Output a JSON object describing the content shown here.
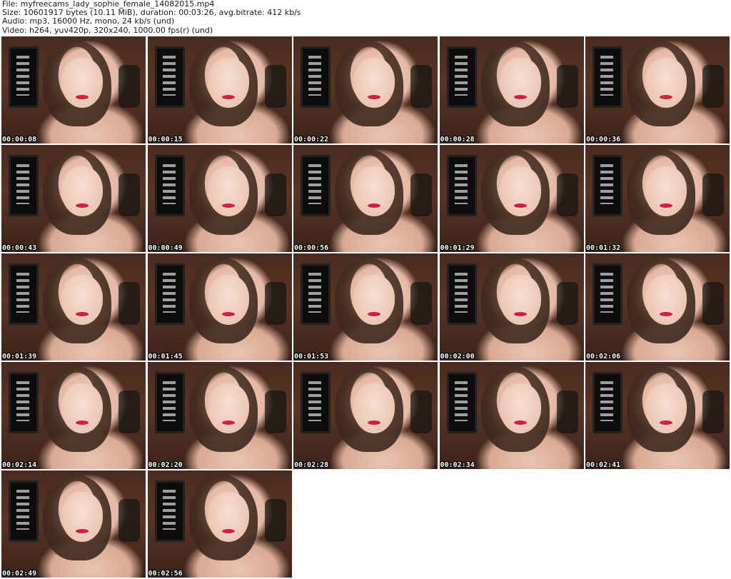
{
  "header": {
    "lines": [
      "File: myfreecams_lady_sophie_female_14082015.mp4",
      "Size: 10601917 bytes (10.11 MiB), duration: 00:03:26, avg.bitrate: 412 kb/s",
      "Audio: mp3, 16000 Hz, mono, 24 kb/s (und)",
      "Video: h264, yuv420p, 320x240, 1000.00 fps(r) (und)"
    ]
  },
  "thumbnails": [
    {
      "timestamp": "00:00:08"
    },
    {
      "timestamp": "00:00:15"
    },
    {
      "timestamp": "00:00:22"
    },
    {
      "timestamp": "00:00:28"
    },
    {
      "timestamp": "00:00:36"
    },
    {
      "timestamp": "00:00:43"
    },
    {
      "timestamp": "00:00:49"
    },
    {
      "timestamp": "00:00:56"
    },
    {
      "timestamp": "00:01:29"
    },
    {
      "timestamp": "00:01:32"
    },
    {
      "timestamp": "00:01:39"
    },
    {
      "timestamp": "00:01:45"
    },
    {
      "timestamp": "00:01:53"
    },
    {
      "timestamp": "00:02:00"
    },
    {
      "timestamp": "00:02:06"
    },
    {
      "timestamp": "00:02:14"
    },
    {
      "timestamp": "00:02:20"
    },
    {
      "timestamp": "00:02:28"
    },
    {
      "timestamp": "00:02:34"
    },
    {
      "timestamp": "00:02:41"
    },
    {
      "timestamp": "00:02:49"
    },
    {
      "timestamp": "00:02:56"
    }
  ],
  "colors": {
    "background": "#ffffff",
    "header_text": "#1a1a1a",
    "timestamp_text": "#ffffff",
    "timestamp_outline": "#000000",
    "lips_accent": "#d11f3f"
  }
}
